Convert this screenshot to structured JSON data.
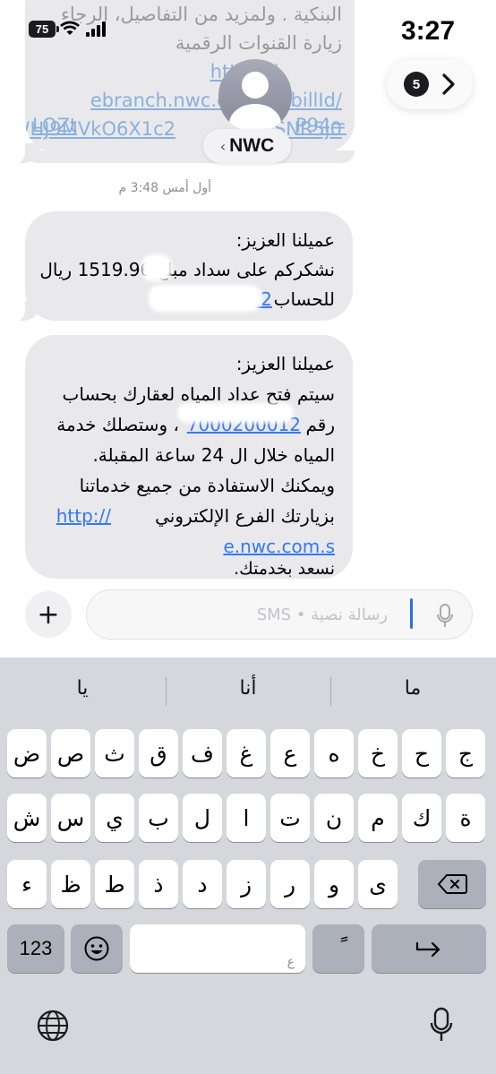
{
  "status_bar": {
    "time": "3:27",
    "battery": "75"
  },
  "header": {
    "contact_name": "NWC",
    "unread_count": "5"
  },
  "previous_message": {
    "lines": [
      "البنكية . ولمزيد من التفاصيل، الرجاء",
      "زيارة القنوات الرقمية",
      "https://",
      "ebranch.nwc.com.sa/billId/",
      "WHJ9MVkO6X1c2",
      "SNR5j0",
      "LOZt",
      "P94="
    ]
  },
  "timestamp": "أول أمس 3:48 م",
  "messages": [
    {
      "line1": "عميلنا العزيز:",
      "line2": "نشكركم على سداد مبلغ 1519.96 ريال",
      "line3_text": "للحساب",
      "line3_link": "7000000012"
    },
    {
      "line1": "عميلنا العزيز:",
      "line2": "سيتم فتح عداد المياه لعقارك بحساب",
      "line3_prefix": "رقم",
      "line3_link": "7000200012",
      "line3_suffix": "، وستصلك خدمة",
      "line4": "المياه خلال ال 24 ساعة المقبلة.",
      "line5": "ويمكنك الاستفادة من جميع خدماتنا",
      "line6_text": "بزيارتك الفرع الإلكتروني",
      "line6_link": "http://",
      "line7_link": "e.nwc.com.s",
      "line8": "نسعد بخدمتك."
    }
  ],
  "compose": {
    "placeholder": "رسالة نصية • SMS",
    "add_label": "+"
  },
  "keyboard": {
    "suggestions": [
      "يا",
      "أنا",
      "ما"
    ],
    "row1": [
      "ض",
      "ص",
      "ث",
      "ق",
      "ف",
      "غ",
      "ع",
      "ه",
      "خ",
      "ح",
      "ج"
    ],
    "row2": [
      "ش",
      "س",
      "ي",
      "ب",
      "ل",
      "ا",
      "ت",
      "ن",
      "م",
      "ك",
      "ة"
    ],
    "row3": [
      "ء",
      "ظ",
      "ط",
      "ذ",
      "د",
      "ز",
      "ر",
      "و",
      "ى"
    ],
    "numbers_key": "123",
    "space_label": "ع",
    "tanween_key": "ً"
  }
}
